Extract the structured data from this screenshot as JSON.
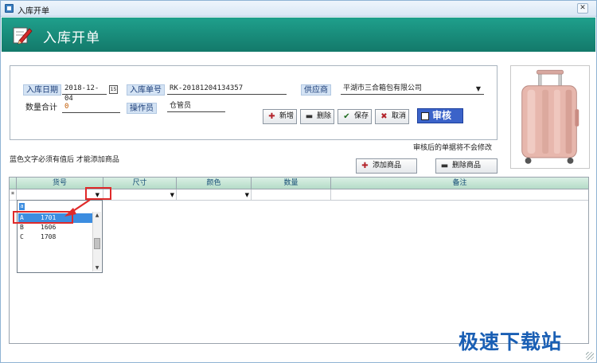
{
  "window": {
    "title": "入库开单",
    "close_glyph": "✕"
  },
  "header": {
    "title": "入库开单",
    "icon": "pencil-document-icon"
  },
  "form": {
    "date_label": "入库日期",
    "date_value": "2018-12-04",
    "calendar_glyph": "15",
    "order_no_label": "入库单号",
    "order_no_value": "RK-20181204134357",
    "supplier_label": "供应商",
    "supplier_value": "平湖市三合箱包有限公司",
    "total_qty_label": "数量合计",
    "total_qty_value": "0",
    "operator_label": "操作员",
    "operator_value": "仓管员"
  },
  "toolbar": {
    "new_label": "新增",
    "delete_label": "删除",
    "save_label": "保存",
    "cancel_label": "取消",
    "audit_label": "审核"
  },
  "notes": {
    "audit_note": "审核后的单据将不会修改",
    "blue_text_note": "蓝色文字必须有值后 才能添加商品"
  },
  "item_buttons": {
    "add_label": "添加商品",
    "remove_label": "删除商品"
  },
  "grid": {
    "columns": [
      "货号",
      "尺寸",
      "颜色",
      "数量",
      "备注"
    ],
    "new_row_indicator": "*"
  },
  "dropdown": {
    "search_value": "a",
    "items": [
      {
        "key": "A",
        "value": "1701",
        "selected": true
      },
      {
        "key": "B",
        "value": "1606",
        "selected": false
      },
      {
        "key": "C",
        "value": "1708",
        "selected": false
      }
    ]
  },
  "colors": {
    "header": "#13796a",
    "highlight": "#e02a2a",
    "selection": "#3c8de0",
    "audit": "#3b63c9"
  },
  "watermark": "极速下载站"
}
